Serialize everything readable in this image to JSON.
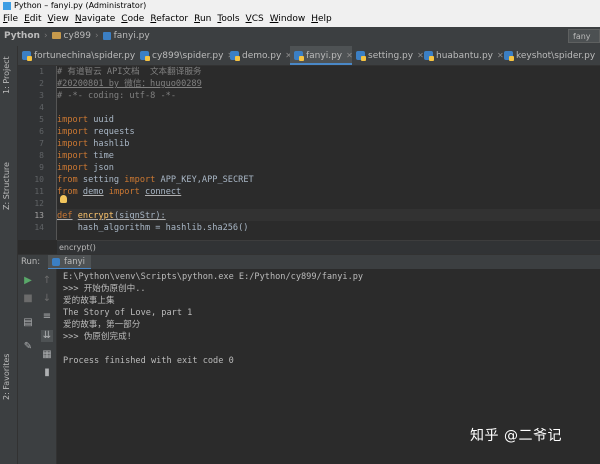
{
  "window": {
    "title": "Python – fanyi.py (Administrator)"
  },
  "menu": [
    "File",
    "Edit",
    "View",
    "Navigate",
    "Code",
    "Refactor",
    "Run",
    "Tools",
    "VCS",
    "Window",
    "Help"
  ],
  "nav": {
    "project": "Python",
    "folder": "cy899",
    "file": "fanyi.py",
    "run_config": "fany"
  },
  "left_strip": {
    "project_tab": "1: Project",
    "structure_tab": "Z: Structure",
    "favorites_tab": "2: Favorites"
  },
  "tabs": [
    {
      "label": "fortunechina\\spider.py"
    },
    {
      "label": "cy899\\spider.py"
    },
    {
      "label": "demo.py"
    },
    {
      "label": "fanyi.py",
      "active": true
    },
    {
      "label": "setting.py"
    },
    {
      "label": "huabantu.py"
    },
    {
      "label": "keyshot\\spider.py"
    }
  ],
  "editor": {
    "line_numbers": [
      "1",
      "2",
      "3",
      "4",
      "5",
      "6",
      "7",
      "8",
      "9",
      "10",
      "11",
      "12",
      "13",
      "14"
    ],
    "current_line": "13",
    "lines": {
      "l1": "# 有道智云 API文档  文本翻译服务",
      "l2": "#20200801 by 微信：huguo00289",
      "l3": "# -*- coding: utf-8 -*-",
      "kw_import": "import",
      "kw_from": "from",
      "kw_def": "def",
      "m_uuid": "uuid",
      "m_requests": "requests",
      "m_hashlib": "hashlib",
      "m_time": "time",
      "m_json": "json",
      "m_setting": "setting",
      "i_setting": "APP_KEY,APP_SECRET",
      "m_demo": "demo",
      "i_demo": "connect",
      "fn_name": "encrypt",
      "fn_args": "(signStr):",
      "l14": "    hash_algorithm = hashlib.sha256()"
    },
    "breadcrumb": "encrypt()"
  },
  "run": {
    "label": "Run:",
    "tab": "fanyi",
    "console": [
      "E:\\Python\\venv\\Scripts\\python.exe E:/Python/cy899/fanyi.py",
      ">>> 开始伪原创中..",
      "爱的故事上集",
      "The Story of Love, part 1",
      "爱的故事，第一部分",
      ">>> 伪原创完成!",
      "",
      "Process finished with exit code 0"
    ]
  },
  "watermark": "知乎 @二爷记"
}
